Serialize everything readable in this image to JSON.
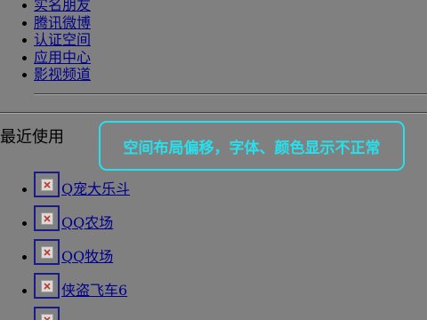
{
  "nav": {
    "items": [
      {
        "label": "实名朋友"
      },
      {
        "label": "腾讯微博"
      },
      {
        "label": "认证空间"
      },
      {
        "label": "应用中心"
      },
      {
        "label": "影视频道"
      }
    ]
  },
  "recent": {
    "heading": "最近使用",
    "apps": [
      {
        "label": "Q宠大乐斗",
        "icon": "broken-image-icon"
      },
      {
        "label": "QQ农场",
        "icon": "broken-image-icon"
      },
      {
        "label": "QQ牧场",
        "icon": "broken-image-icon"
      },
      {
        "label": "侠盗飞车6",
        "icon": "broken-image-icon"
      },
      {
        "label": "",
        "icon": "broken-image-icon"
      }
    ]
  },
  "annotation": {
    "text": "空间布局偏移，字体、颜色显示不正常",
    "color": "#27e0ee"
  },
  "colors": {
    "background": "#808080",
    "link": "#00008b",
    "icon_border": "#1a1a8a",
    "broken_image_x": "#c0392b"
  }
}
